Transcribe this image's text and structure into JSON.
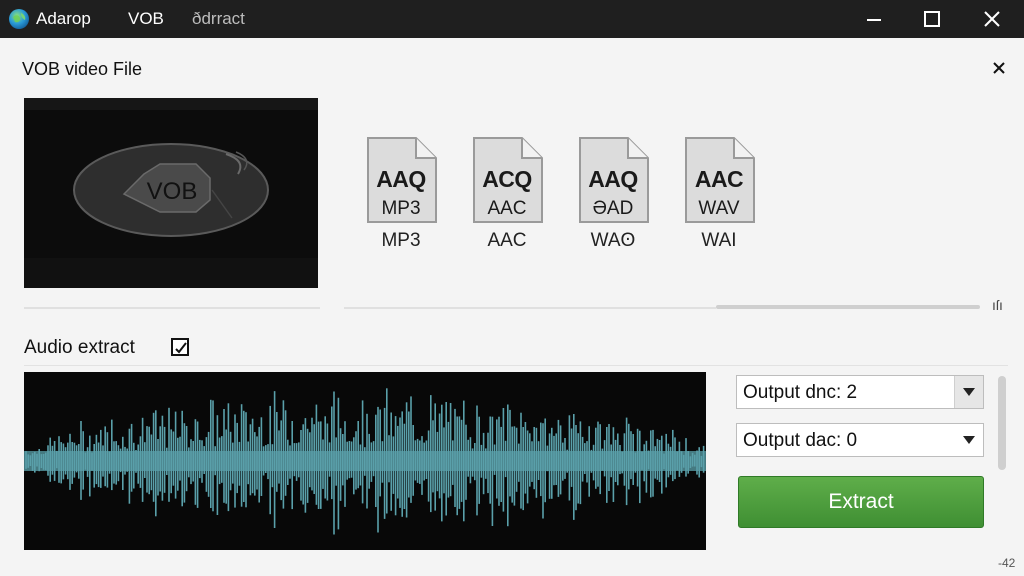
{
  "titlebar": {
    "segments": [
      "Adarop",
      "VOB",
      "ðdrract"
    ]
  },
  "panel": {
    "title": "VOB video File"
  },
  "preview": {
    "badge": "VOB"
  },
  "formats": [
    {
      "top": "AAQ",
      "mid": "MP3",
      "label": "MP3"
    },
    {
      "top": "ACQ",
      "mid": "AAC",
      "label": "AAC"
    },
    {
      "top": "AAQ",
      "mid": "ƏAD",
      "label": "WAʘ"
    },
    {
      "top": "AAC",
      "mid": "WAV",
      "label": "WAI"
    }
  ],
  "corner_glyph": "ıſı",
  "audio": {
    "label": "Audio extract",
    "checked": true
  },
  "outputs": {
    "dropdown1": "Output dnc: 2",
    "dropdown2": "Output dac: 0"
  },
  "extract_button": "Extract",
  "corner_number": "-42",
  "colors": {
    "titlebar": "#1f1f1f",
    "accent_green": "#4a9e3c",
    "waveform": "#5aa0aa"
  },
  "icons": {
    "app": "app-globe-icon",
    "minimize": "minimize-icon",
    "maximize": "maximize-icon",
    "close": "close-icon",
    "panel_close": "close-icon",
    "dropdown": "chevron-down-icon",
    "file": "file-icon"
  }
}
